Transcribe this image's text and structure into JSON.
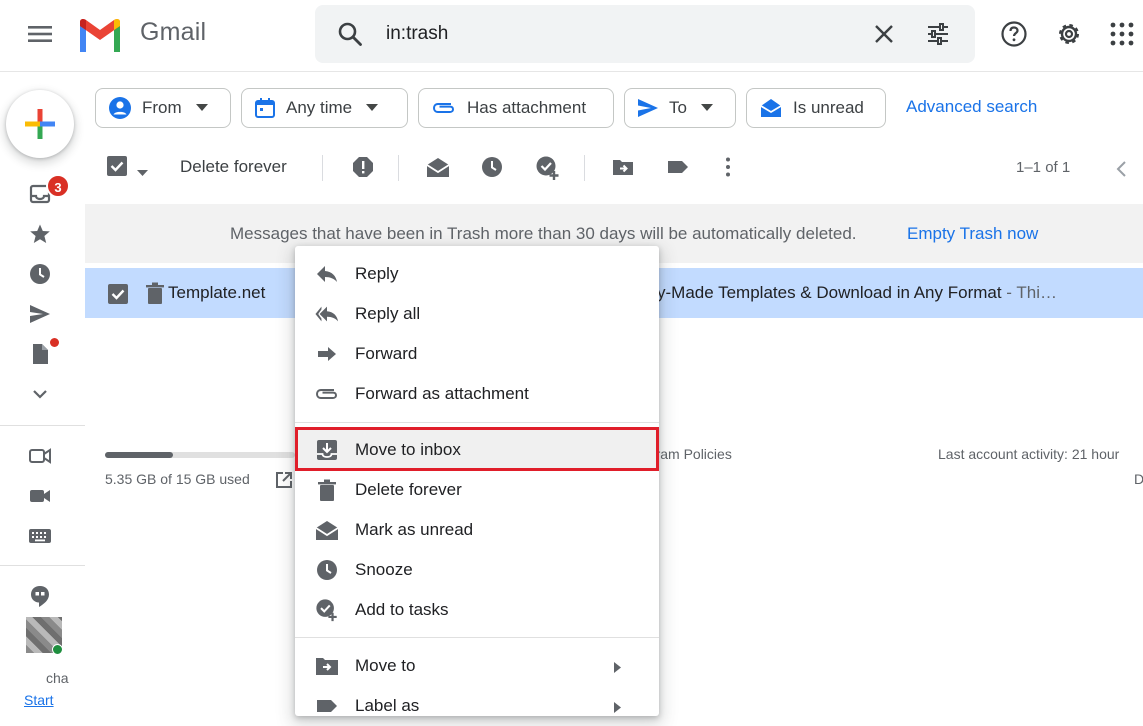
{
  "header": {
    "app_name": "Gmail",
    "search_query": "in:trash"
  },
  "rail": {
    "inbox_badge": "3",
    "chat_text": "cha",
    "start_link": "Start"
  },
  "filters": {
    "chips": [
      "From",
      "Any time",
      "Has attachment",
      "To",
      "Is unread"
    ],
    "advanced_search": "Advanced search"
  },
  "toolbar": {
    "delete_forever": "Delete forever",
    "pager": "1–1 of 1"
  },
  "trash_notice": {
    "message": "Messages that have been in Trash more than 30 days will be automatically deleted.",
    "empty_trash": "Empty Trash now"
  },
  "email": {
    "sender": "Template.net",
    "subject": "y-Made Templates & Download in Any Format",
    "snippet": " - Thi…"
  },
  "footer": {
    "storage_used": "5.35 GB of 15 GB used",
    "storage_fraction": 0.357,
    "policies": "ogram Policies",
    "last_activity": "Last account activity: 21 hour",
    "details": "D"
  },
  "context_menu": {
    "items": [
      {
        "label": "Reply",
        "icon": "reply-icon"
      },
      {
        "label": "Reply all",
        "icon": "reply-all-icon"
      },
      {
        "label": "Forward",
        "icon": "forward-icon"
      },
      {
        "label": "Forward as attachment",
        "icon": "attachment-icon"
      },
      {
        "label": "Move to inbox",
        "icon": "move-to-inbox-icon"
      },
      {
        "label": "Delete forever",
        "icon": "trash-icon"
      },
      {
        "label": "Mark as unread",
        "icon": "mark-unread-icon"
      },
      {
        "label": "Snooze",
        "icon": "clock-icon"
      },
      {
        "label": "Add to tasks",
        "icon": "add-task-icon"
      },
      {
        "label": "Move to",
        "icon": "move-to-icon"
      },
      {
        "label": "Label as",
        "icon": "label-icon"
      }
    ]
  },
  "colors": {
    "accent_blue": "#1a73e8",
    "selected_row": "#c2dbff",
    "highlight_red": "#e01e2a",
    "badge_red": "#d93025"
  }
}
